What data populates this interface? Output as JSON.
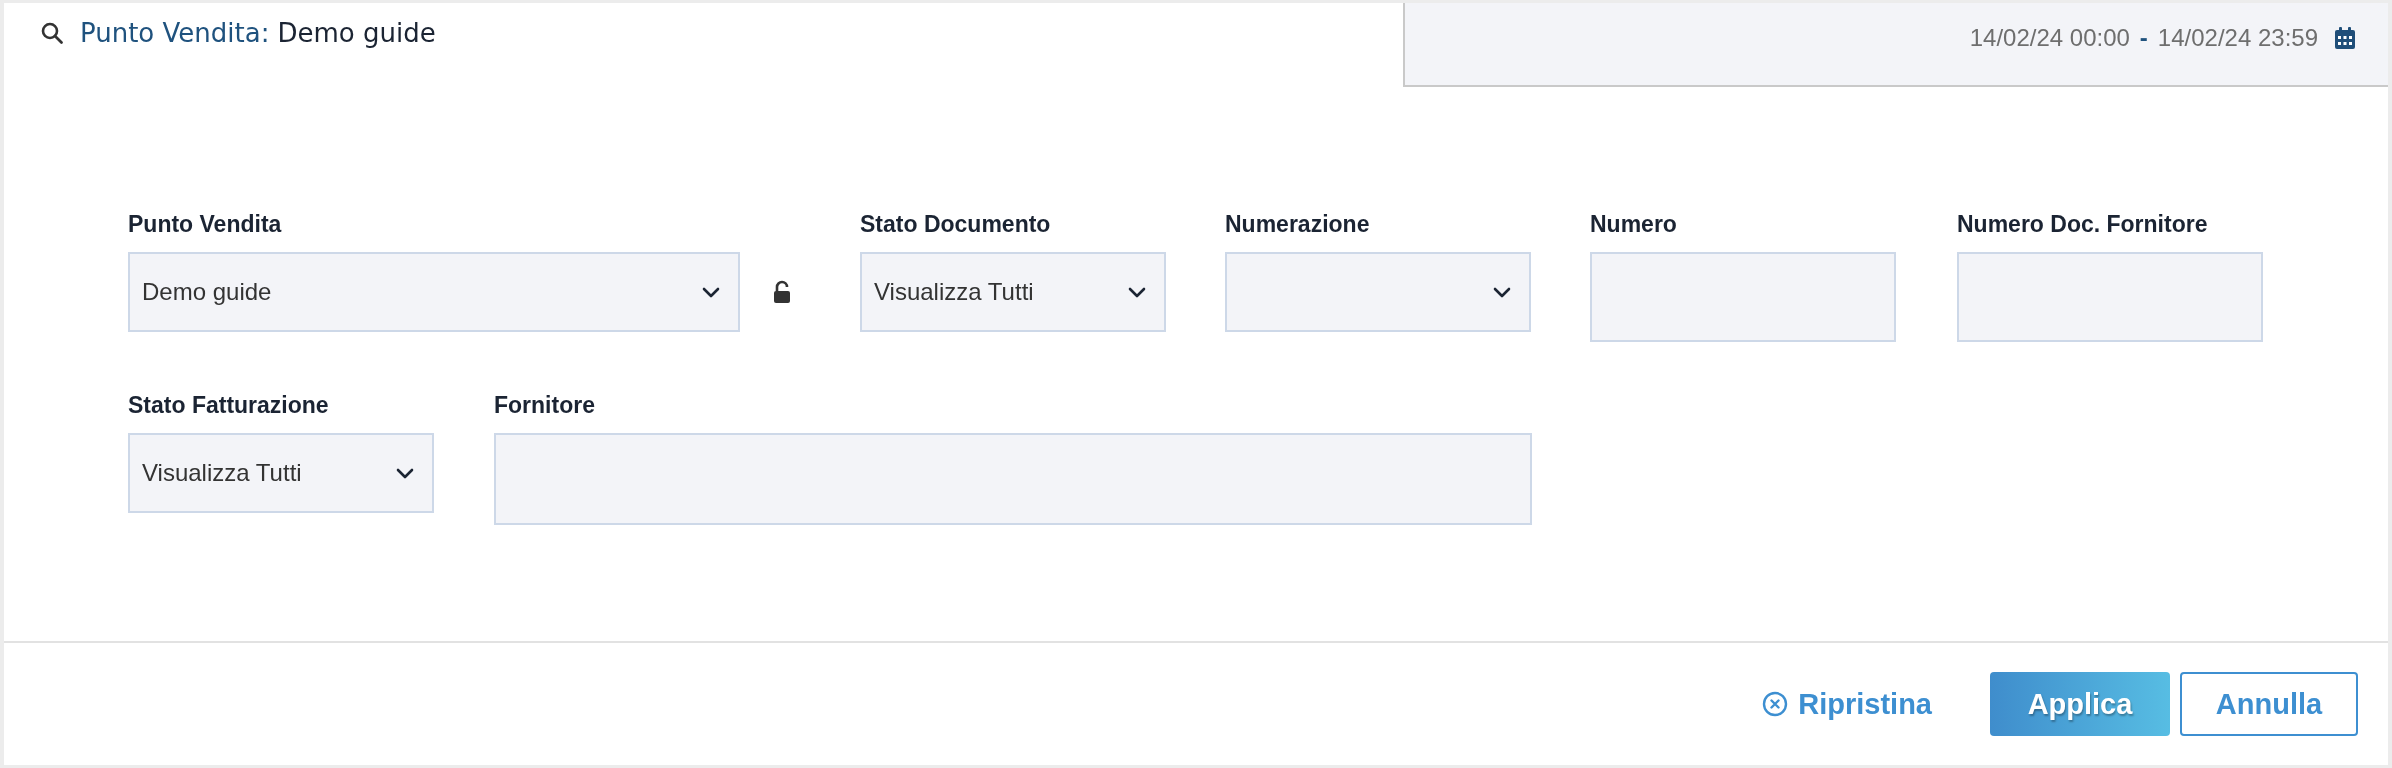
{
  "header": {
    "filter_label": "Punto Vendita:",
    "filter_value": "Demo guide",
    "date_start": "14/02/24 00:00",
    "date_separator": "-",
    "date_end": "14/02/24 23:59"
  },
  "rows": [
    [
      {
        "kind": "select",
        "label": "Punto Vendita",
        "value": "Demo guide",
        "locked": false
      },
      {
        "kind": "select",
        "label": "Stato Documento",
        "value": "Visualizza Tutti"
      },
      {
        "kind": "select",
        "label": "Numerazione"
      },
      {
        "kind": "text",
        "label": "Numero"
      },
      {
        "kind": "text",
        "label": "Numero Doc. Fornitore"
      }
    ],
    [
      {
        "kind": "select",
        "label": "Stato Fatturazione",
        "value": "Visualizza Tutti"
      },
      {
        "kind": "text",
        "label": "Fornitore"
      }
    ]
  ],
  "footer": {
    "reset": "Ripristina",
    "apply": "Applica",
    "cancel": "Annulla"
  }
}
